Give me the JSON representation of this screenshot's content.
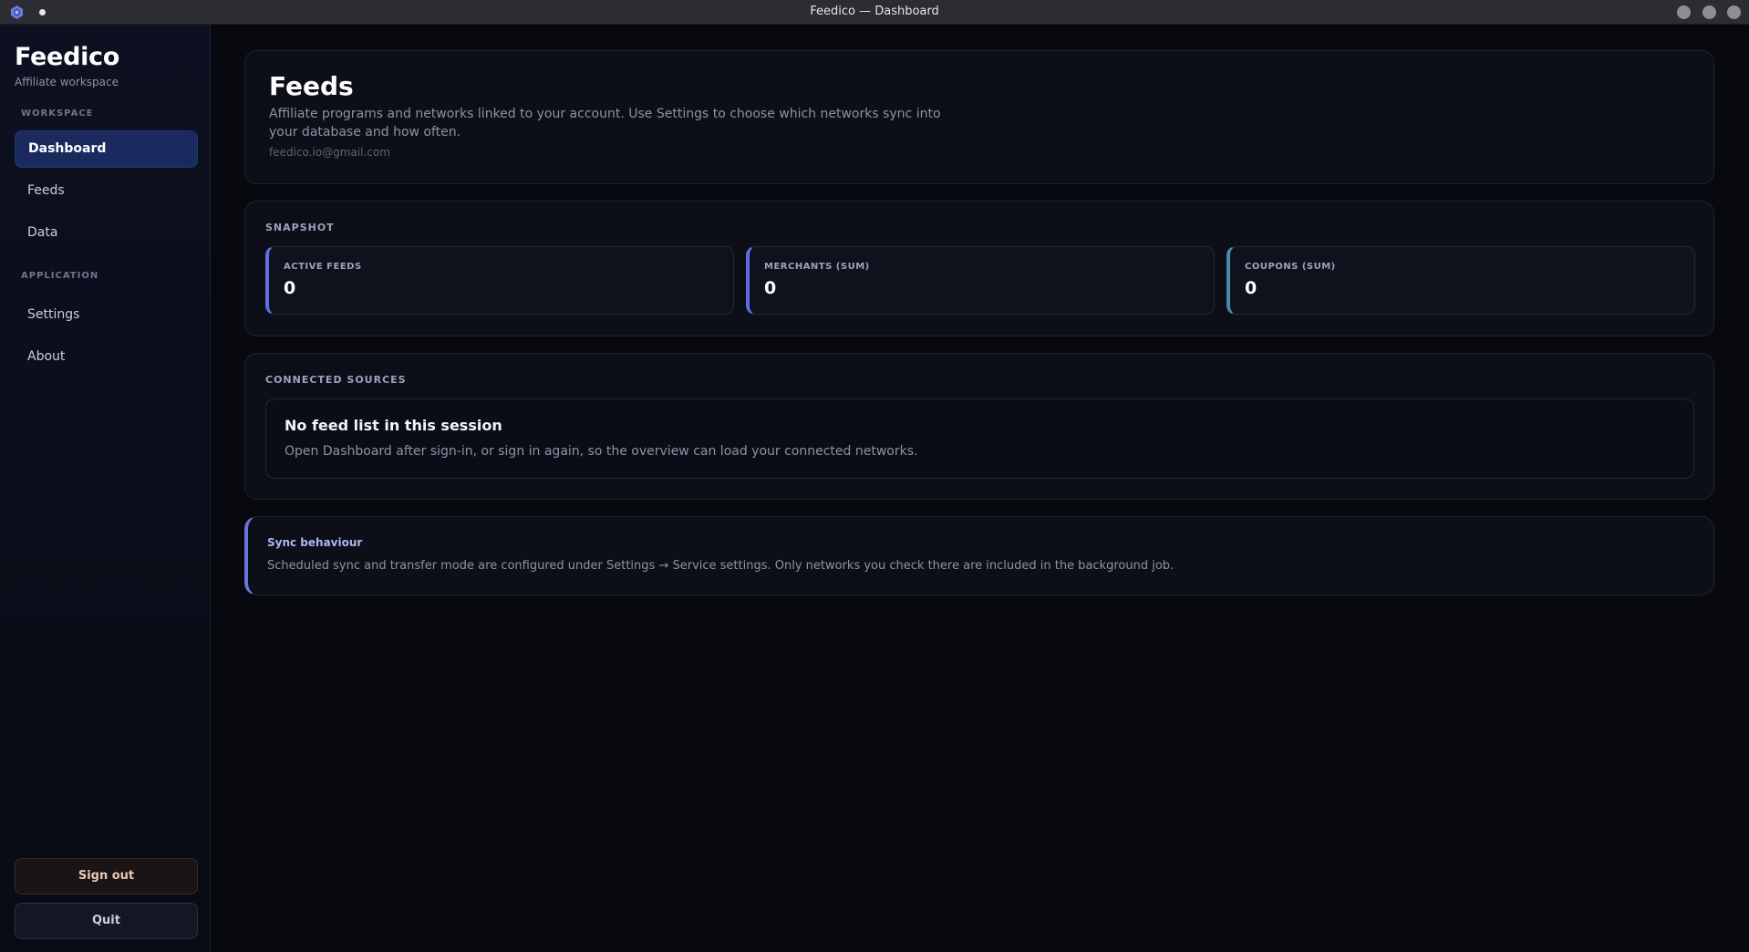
{
  "window": {
    "title": "Feedico — Dashboard",
    "app_icon": "app-logo-icon",
    "controls": [
      "minimize-icon",
      "maximize-icon",
      "close-icon"
    ]
  },
  "sidebar": {
    "brand": "Feedico",
    "subtitle": "Affiliate workspace",
    "sections": {
      "workspace": "WORKSPACE",
      "application": "APPLICATION"
    },
    "items": [
      {
        "label": "Dashboard",
        "active": true
      },
      {
        "label": "Feeds",
        "active": false
      },
      {
        "label": "Data",
        "active": false
      },
      {
        "label": "Settings",
        "active": false
      },
      {
        "label": "About",
        "active": false
      }
    ],
    "sign_out": "Sign out",
    "quit": "Quit"
  },
  "header": {
    "title": "Feeds",
    "description": "Affiliate programs and networks linked to your account. Use Settings to choose which networks sync into your database and how often.",
    "email": "feedico.io@gmail.com"
  },
  "snapshot": {
    "label": "SNAPSHOT",
    "stats": [
      {
        "label": "ACTIVE FEEDS",
        "value": "0"
      },
      {
        "label": "MERCHANTS (SUM)",
        "value": "0"
      },
      {
        "label": "COUPONS (SUM)",
        "value": "0"
      }
    ]
  },
  "sources": {
    "label": "CONNECTED SOURCES",
    "empty_title": "No feed list in this session",
    "empty_description": "Open Dashboard after sign-in, or sign in again, so the overview can load your connected networks."
  },
  "sync": {
    "title": "Sync behaviour",
    "description": "Scheduled sync and transfer mode are configured under Settings → Service settings. Only networks you check there are included in the background job."
  },
  "colors": {
    "accent": "#5f6ee0",
    "active_nav": "#1a2a5e",
    "background": "#07090e",
    "panel": "#0c0f17"
  }
}
